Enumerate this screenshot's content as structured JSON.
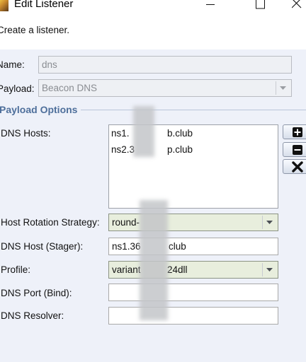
{
  "window": {
    "title": "Edit Listener",
    "description": "Create a listener."
  },
  "form": {
    "name_label": "Name:",
    "name_value": "dns",
    "payload_label": "Payload:",
    "payload_value": "Beacon DNS"
  },
  "payload_options": {
    "section_title": "Payload Options",
    "dns_hosts_label": "DNS Hosts:",
    "dns_hosts": [
      "ns1.",
      "ns2.3"
    ],
    "dns_hosts_suffixes": [
      "b.club",
      "p.club"
    ],
    "host_rotation_label": "Host Rotation Strategy:",
    "host_rotation_value": "round-",
    "dns_host_stager_label": "DNS Host (Stager):",
    "dns_host_stager_value": "ns1.36",
    "dns_host_stager_suffix": "club",
    "profile_label": "Profile:",
    "profile_value": "variant",
    "profile_suffix": "24dll",
    "dns_port_label": "DNS Port (Bind):",
    "dns_port_value": "",
    "dns_resolver_label": "DNS Resolver:",
    "dns_resolver_value": ""
  },
  "icons": {
    "add": "plus-icon",
    "remove": "minus-icon",
    "clear": "x-icon",
    "dropdown": "chevron-down-icon"
  },
  "colors": {
    "section_title": "#4e6f9b",
    "background": "#eef1f9"
  }
}
